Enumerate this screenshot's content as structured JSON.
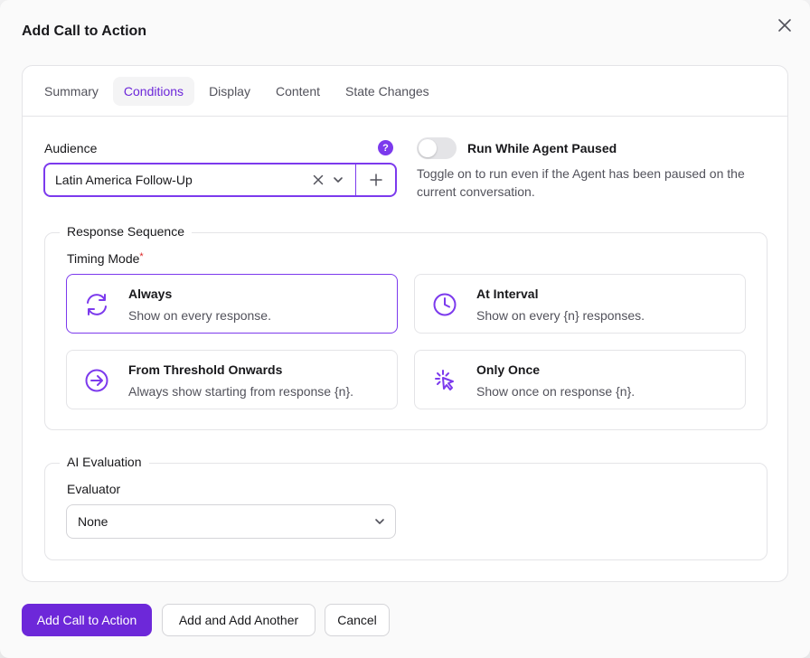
{
  "modal": {
    "title": "Add Call to Action"
  },
  "tabs": [
    {
      "label": "Summary",
      "active": false
    },
    {
      "label": "Conditions",
      "active": true
    },
    {
      "label": "Display",
      "active": false
    },
    {
      "label": "Content",
      "active": false
    },
    {
      "label": "State Changes",
      "active": false
    }
  ],
  "audience": {
    "label": "Audience",
    "help": "?",
    "value": "Latin America Follow-Up"
  },
  "run_while_paused": {
    "label": "Run While Agent Paused",
    "enabled": false,
    "description": "Toggle on to run even if the Agent has been paused on the current conversation."
  },
  "response_sequence": {
    "legend": "Response Sequence",
    "timing_label": "Timing Mode",
    "required_mark": "*",
    "options": [
      {
        "title": "Always",
        "desc": "Show on every response.",
        "icon": "refresh-icon",
        "selected": true
      },
      {
        "title": "At Interval",
        "desc": "Show on every {n} responses.",
        "icon": "clock-icon",
        "selected": false
      },
      {
        "title": "From Threshold Onwards",
        "desc": "Always show starting from response {n}.",
        "icon": "arrow-right-circle-icon",
        "selected": false
      },
      {
        "title": "Only Once",
        "desc": "Show once on response {n}.",
        "icon": "click-pointer-icon",
        "selected": false
      }
    ]
  },
  "ai_evaluation": {
    "legend": "AI Evaluation",
    "evaluator_label": "Evaluator",
    "evaluator_value": "None"
  },
  "footer": {
    "primary": "Add Call to Action",
    "add_another": "Add and Add Another",
    "cancel": "Cancel"
  },
  "colors": {
    "accent": "#7c3aed",
    "primary_button": "#6d28d9",
    "required": "#dc2626"
  }
}
